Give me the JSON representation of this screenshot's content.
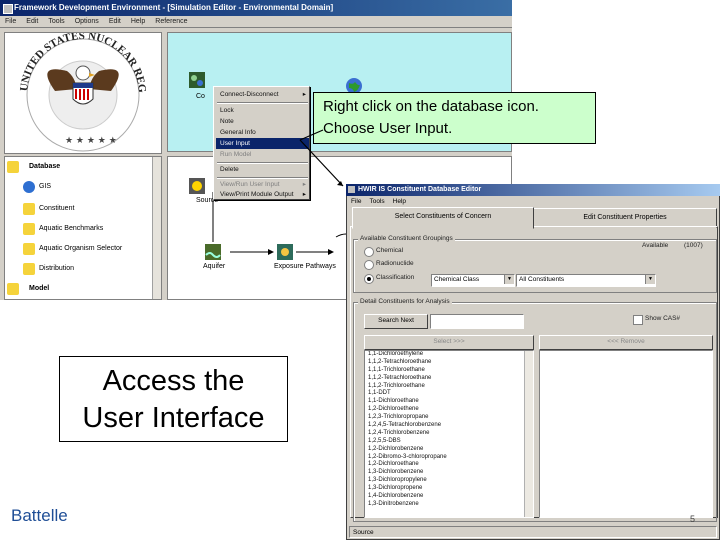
{
  "main_window": {
    "title": "Framework Development Environment - [Simulation Editor - Environmental Domain]",
    "menu": [
      "File",
      "Edit",
      "Tools",
      "Options",
      "Edit",
      "Help",
      "Reference"
    ]
  },
  "tree": {
    "items": [
      {
        "label": "Database",
        "icon": "database-icon"
      },
      {
        "label": "GIS",
        "icon": "globe-icon"
      },
      {
        "label": "Constituent",
        "icon": "radiation-icon"
      },
      {
        "label": "Aquatic Benchmarks",
        "icon": "radiation-icon"
      },
      {
        "label": "Aquatic Organism Selector",
        "icon": "radiation-icon"
      },
      {
        "label": "Distribution",
        "icon": "radiation-icon"
      },
      {
        "label": "Model",
        "icon": "model-icon"
      }
    ]
  },
  "context_menu": {
    "items": [
      {
        "label": "Connect-Disconnect",
        "submenu": true
      },
      {
        "label": "Lock"
      },
      {
        "label": "Note"
      },
      {
        "label": "General Info"
      },
      {
        "label": "User Input",
        "selected": true
      },
      {
        "label": "Run Model",
        "disabled": true
      },
      {
        "label": "Delete"
      },
      {
        "label": "View/Run User Input",
        "disabled": true,
        "submenu": true
      },
      {
        "label": "View/Print Module Output",
        "submenu": true
      }
    ]
  },
  "canvas": {
    "nodes": [
      {
        "label": "Co"
      },
      {
        "label": "Source"
      },
      {
        "label": "Aquifer"
      },
      {
        "label": "Exposure Pathways"
      }
    ]
  },
  "callout": {
    "line1": "Right click on the database icon.",
    "line2": "Choose User Input."
  },
  "dialog": {
    "title": "HWIR IS Constituent Database Editor",
    "menu": [
      "File",
      "Tools",
      "Help"
    ],
    "tabs": [
      "Select Constituents of Concern",
      "Edit Constituent Properties"
    ],
    "group_available": "Available Constituent Groupings",
    "available_label": "Available",
    "available_count": "(1007)",
    "radios": [
      {
        "label": "Chemical",
        "on": false
      },
      {
        "label": "Radionuclide",
        "on": false
      },
      {
        "label": "Classification",
        "on": true
      }
    ],
    "class_combo": "Chemical Class",
    "class_combo2": "All Constituents",
    "group_detail": "Detail Constituents for Analysis",
    "search_button": "Search Next",
    "show_cas_label": "Show CAS#",
    "select_button": "Select >>>",
    "remove_button": "<<< Remove",
    "list_items": [
      "1,1-Dichloroethylene",
      "1,1,2-Tetrachloroethane",
      "1,1,1-Trichloroethane",
      "1,1,2-Tetrachloroethane",
      "1,1,2-Trichloroethane",
      "1,1-DDT",
      "1,1-Dichloroethane",
      "1,2-Dichloroethene",
      "1,2,3-Trichloropropane",
      "1,2,4,5-Tetrachlorobenzene",
      "1,2,4-Trichlorobenzene",
      "1,2,5,5-DBS",
      "1,2-Dichlorobenzene",
      "1,2-Dibromo-3-chloropropane",
      "1,2-Dichloroethane",
      "1,3-Dichlorobenzene",
      "1,3-Dichloropropylene",
      "1,3-Dichloropropene",
      "1,4-Dichlorobenzene",
      "1,3-Dinitrobenzene"
    ],
    "status": "Source"
  },
  "access_box": {
    "line1": "Access the",
    "line2": "User Interface"
  },
  "footer": {
    "brand": "Battelle",
    "page_number": "5"
  },
  "colors": {
    "titlebar": "#0a246a",
    "canvas_top": "#b8f0f2",
    "callout_bg": "#ccffcc",
    "selection": "#0a246a",
    "brand": "#1f4e96"
  }
}
